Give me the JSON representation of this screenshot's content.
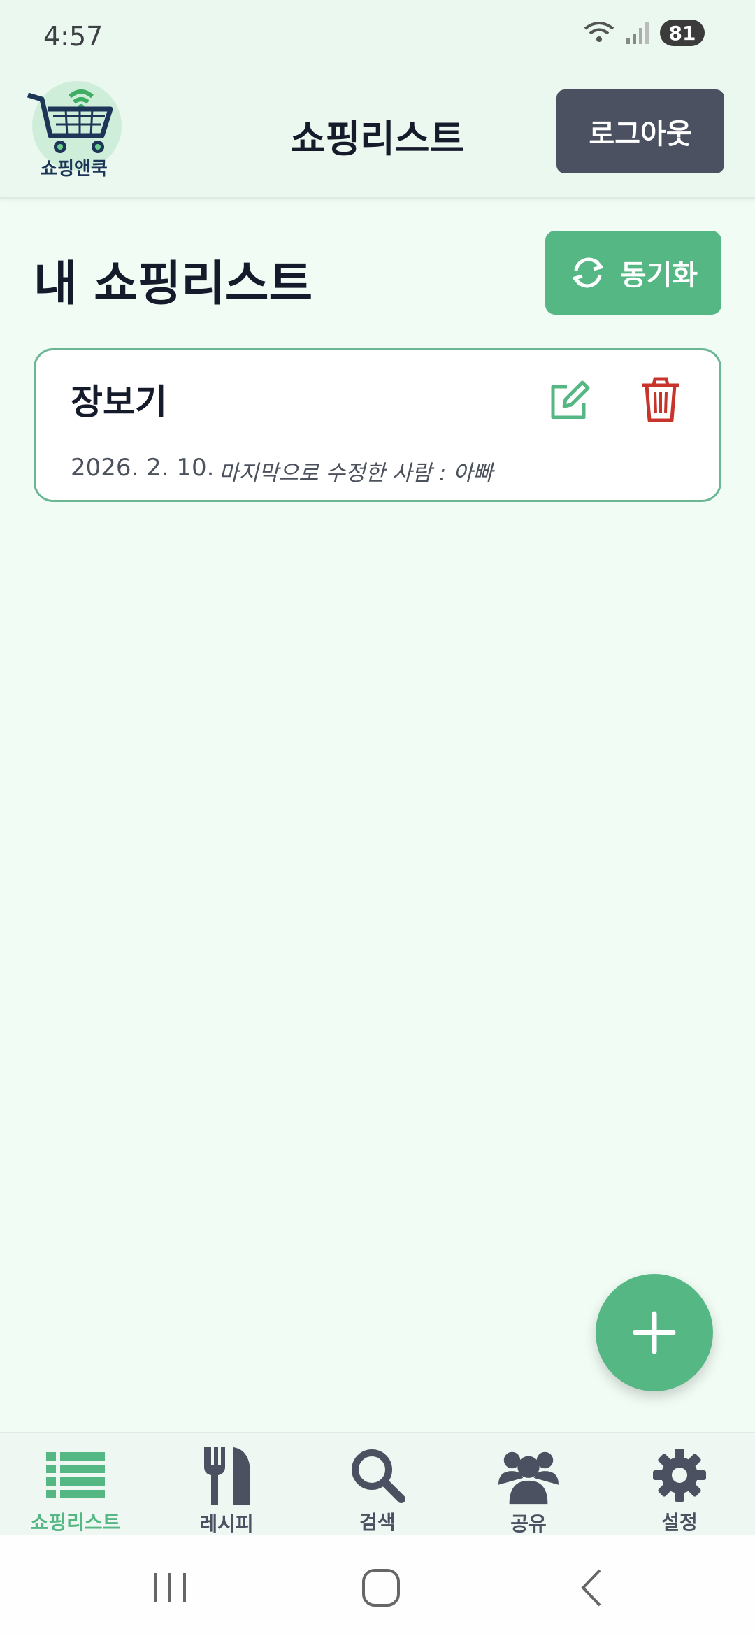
{
  "status_bar": {
    "time": "4:57",
    "battery": "81",
    "icons": [
      "wifi-icon",
      "signal-icon",
      "battery-icon"
    ]
  },
  "header": {
    "logo_text": "쇼핑앤쿡",
    "title": "쇼핑리스트",
    "logout_label": "로그아웃"
  },
  "page": {
    "title": "내 쇼핑리스트",
    "sync_label": "동기화"
  },
  "lists": [
    {
      "name": "장보기",
      "date": "2026. 2. 10.",
      "editor": "마지막으로 수정한 사람 : 아빠"
    }
  ],
  "bottom_nav": [
    {
      "label": "쇼핑리스트",
      "icon": "list-icon",
      "active": true
    },
    {
      "label": "레시피",
      "icon": "fork-knife-icon",
      "active": false
    },
    {
      "label": "검색",
      "icon": "search-icon",
      "active": false
    },
    {
      "label": "공유",
      "icon": "people-icon",
      "active": false
    },
    {
      "label": "설정",
      "icon": "gear-icon",
      "active": false
    }
  ],
  "colors": {
    "accent": "#55b784",
    "dark_button": "#4b5160",
    "danger": "#c8332c",
    "background": "#f1fcf4"
  }
}
